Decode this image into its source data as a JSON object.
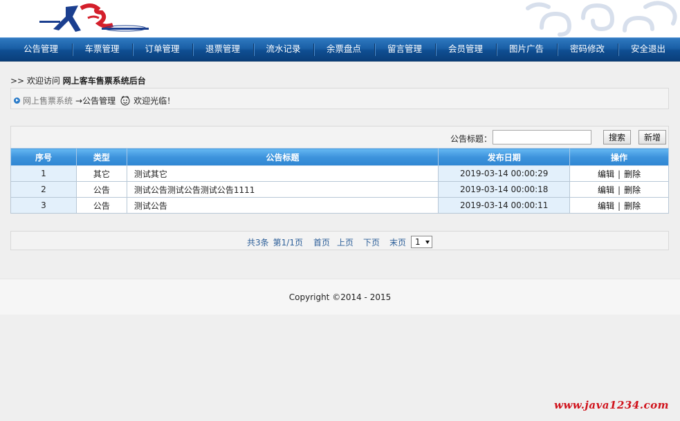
{
  "nav": {
    "items": [
      {
        "label": "公告管理",
        "width": 90
      },
      {
        "label": "车票管理",
        "width": 87
      },
      {
        "label": "订单管理",
        "width": 87
      },
      {
        "label": "退票管理",
        "width": 88
      },
      {
        "label": "流水记录",
        "width": 87
      },
      {
        "label": "余票盘点",
        "width": 88
      },
      {
        "label": "留言管理",
        "width": 88
      },
      {
        "label": "会员管理",
        "width": 88
      },
      {
        "label": "图片广告",
        "width": 88
      },
      {
        "label": "密码修改",
        "width": 88
      },
      {
        "label": "安全退出",
        "width": 88
      }
    ]
  },
  "welcome": {
    "prefix": ">> 欢迎访问",
    "system_name": "网上客车售票系统后台"
  },
  "breadcrumb": {
    "system": "网上售票系统",
    "arrow": "→",
    "current": "公告管理",
    "hello": "欢迎光临！"
  },
  "search": {
    "label": "公告标题：",
    "value": "",
    "placeholder": "",
    "search_button": "搜索",
    "add_button": "新增"
  },
  "table": {
    "headers": [
      "序号",
      "类型",
      "公告标题",
      "发布日期",
      "操作"
    ],
    "rows": [
      {
        "no": "1",
        "type": "其它",
        "title": "测试其它",
        "date": "2019-03-14 00:00:29",
        "edit": "编辑",
        "sep": "|",
        "delete": "删除"
      },
      {
        "no": "2",
        "type": "公告",
        "title": "测试公告测试公告测试公告1111",
        "date": "2019-03-14 00:00:18",
        "edit": "编辑",
        "sep": "|",
        "delete": "删除"
      },
      {
        "no": "3",
        "type": "公告",
        "title": "测试公告",
        "date": "2019-03-14 00:00:11",
        "edit": "编辑",
        "sep": "|",
        "delete": "删除"
      }
    ]
  },
  "pager": {
    "total": "共3条",
    "page_info": "第1/1页",
    "first": "首页",
    "prev": "上页",
    "next": "下页",
    "last": "末页",
    "selected_page": "1"
  },
  "footer": {
    "copyright": "Copyright ©2014 - 2015"
  },
  "watermark": "www.java1234.com",
  "colors": {
    "nav_bg": "#1a5fa6",
    "table_header": "#3d93dc",
    "row_shade": "#e3f0fb",
    "pager_link": "#2c5f99",
    "watermark": "#d0121b"
  }
}
